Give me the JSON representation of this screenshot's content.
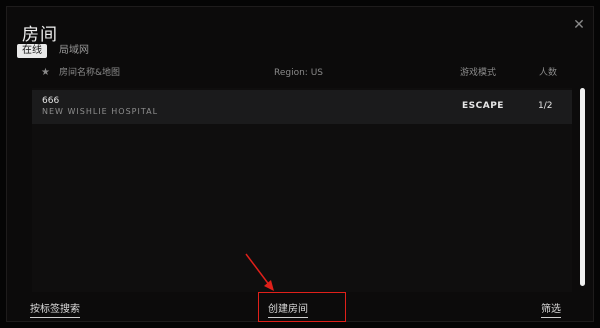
{
  "window": {
    "title": "房间",
    "close_icon": "close-icon"
  },
  "tabs": [
    {
      "label": "在线",
      "active": true
    },
    {
      "label": "局域网",
      "active": false
    }
  ],
  "columns": {
    "star_icon": "★",
    "name": "房间名称&地图",
    "region": "Region: US",
    "mode": "游戏模式",
    "count": "人数"
  },
  "rooms": [
    {
      "name": "666",
      "map": "NEW WISHLIE HOSPITAL",
      "mode": "ESCAPE",
      "count": "1/2"
    }
  ],
  "buttons": {
    "search_tags": "按标签搜索",
    "create_room": "创建房间",
    "filter": "筛选"
  },
  "colors": {
    "annotation": "#e0201a",
    "active_tab_bg": "#e9e9e9"
  }
}
